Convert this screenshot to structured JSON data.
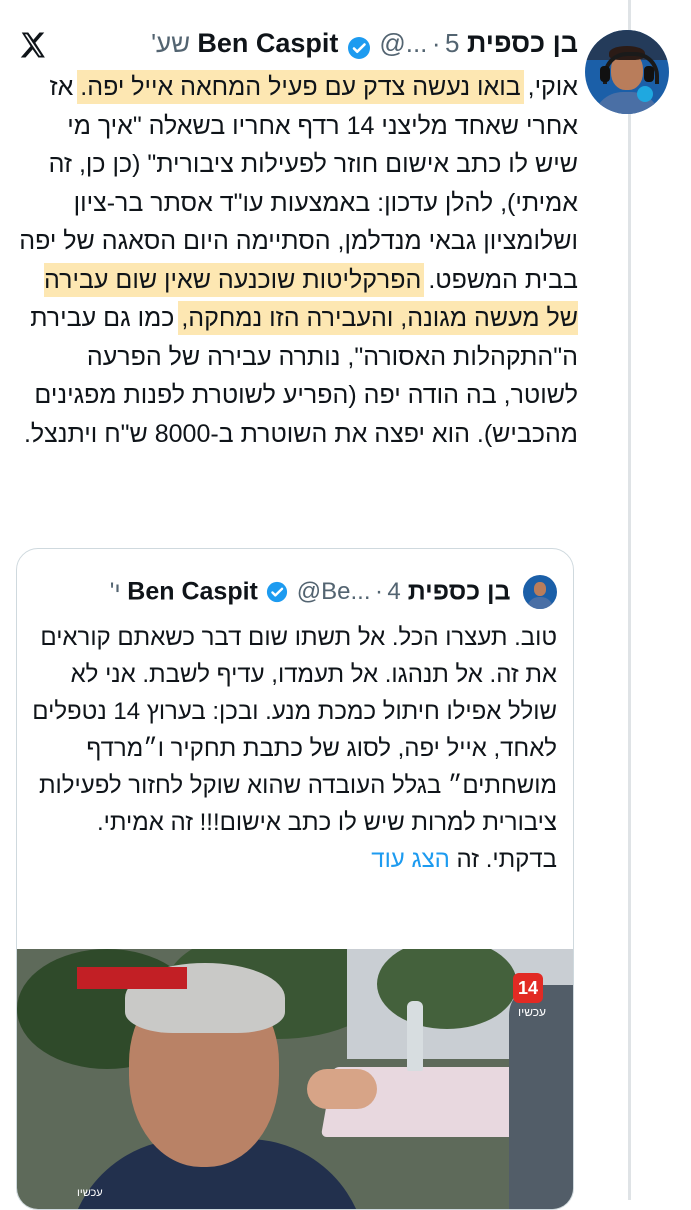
{
  "tweet": {
    "author_name": "בן כספית Ben Caspit",
    "handle": "@...",
    "separator": "·",
    "time": "5 שע'",
    "text_segments": [
      {
        "text": "אוקי, ",
        "highlight": false
      },
      {
        "text": "בואו נעשה צדק עם פעיל המחאה אייל יפה.",
        "highlight": true
      },
      {
        "text": " אז אחרי שאחד מליצני 14 רדף אחריו בשאלה \"איך מי שיש לו כתב אישום חוזר לפעילות ציבורית\" (כן כן, זה אמיתי), להלן עדכון: באמצעות עו\"ד אסתר בר-ציון ושלומציון גבאי מנדלמן, הסתיימה היום הסאגה של יפה בבית המשפט. ",
        "highlight": false
      },
      {
        "text": "הפרקליטות שוכנעה שאין שום עבירה של מעשה מגונה, והעבירה הזו נמחקה,",
        "highlight": true
      },
      {
        "text": " כמו גם עבירת ה\"התקהלות האסורה\", נותרה עבירה של הפרעה לשוטר, בה הודה יפה (הפריע לשוטרת לפנות מפגינים מהכביש). הוא יפצה את השוטרת ב-8000 ש\"ח ויתנצל.",
        "highlight": false
      }
    ]
  },
  "quoted": {
    "author_name": "בן כספית Ben Caspit",
    "handle": "@Be...",
    "separator": "·",
    "time": "4 י'",
    "text": "טוב. תעצרו הכל. אל תשתו שום דבר כשאתם קוראים את זה. אל תנהגו. אל תעמדו, עדיף לשבת. אני לא שולל אפילו חיתול כמכת מנע. ובכן: בערוץ 14 נטפלים לאחד, אייל יפה, לסוג של כתבת תחקיר ו״מרדף מושחתים״ בגלל העובדה שהוא שוקל לחזור לפעילות ציבורית למרות שיש לו כתב אישום!!! זה אמיתי. בדקתי. זה ",
    "show_more": "הצג עוד"
  },
  "media": {
    "channel_logo": "14",
    "channel_caption": "עכשיו",
    "lower_caption": "עכשיו"
  },
  "colors": {
    "highlight": "#fde7b2",
    "link": "#1d9bf0",
    "verified": "#1d9bf0",
    "meta": "#536471"
  }
}
